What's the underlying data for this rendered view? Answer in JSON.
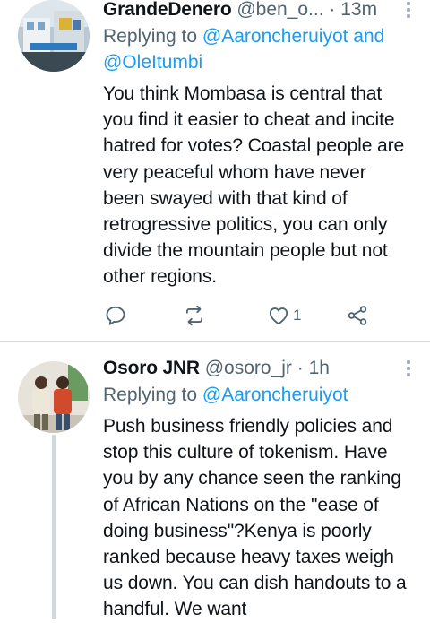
{
  "tweets": [
    {
      "author": "GrandeDenero",
      "handle": "@ben_o...",
      "time": "· 13m",
      "replying_prefix": "Replying to",
      "replying_to": "@Aaroncheruiyot and",
      "replying_to_line2": "@OleItumbi",
      "body": "You think Mombasa is central that you find it easier to cheat and incite hatred for votes? Coastal people are very peaceful whom have never been swayed with that kind of retrogressive politics, you can only divide the mountain people but not other regions.",
      "like_count": "1",
      "icons": [
        "reply-icon",
        "retweet-icon",
        "heart-icon",
        "share-icon",
        "more-icon"
      ]
    },
    {
      "author": "Osoro JNR",
      "handle": "@osoro_jr",
      "time": "· 1h",
      "replying_prefix": "Replying to",
      "replying_to": "@Aaroncheruiyot",
      "body": "Push business friendly policies and stop this culture of tokenism. Have you by any chance seen the ranking of African Nations on the \"ease of doing business\"?Kenya is poorly ranked because heavy taxes weigh us down. You can dish handouts to a handful. We want"
    }
  ],
  "colors": {
    "text": "#0f1419",
    "secondary": "#536471",
    "link": "#1d9bf0",
    "divider": "#d9dde1"
  }
}
